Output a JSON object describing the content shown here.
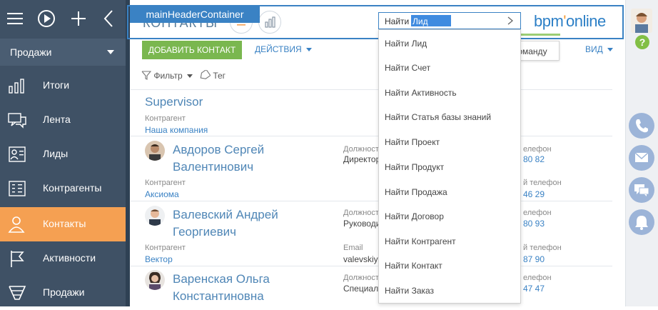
{
  "sidebar": {
    "section_label": "Продажи",
    "items": [
      {
        "label": "Итоги"
      },
      {
        "label": "Лента"
      },
      {
        "label": "Лиды"
      },
      {
        "label": "Контрагенты"
      },
      {
        "label": "Контакты"
      },
      {
        "label": "Активности"
      },
      {
        "label": "Продажи"
      }
    ]
  },
  "header": {
    "container_label": "mainHeaderContainer",
    "page_title": "КОНТАКТЫ",
    "command": {
      "typed": "Найти",
      "selected": "Лид"
    },
    "logo": {
      "left": "bpm",
      "dot": "'",
      "right": "online"
    }
  },
  "toolbar": {
    "add_label": "ДОБАВИТЬ КОНТАКТ",
    "actions_label": "ДЕЙСТВИЯ",
    "view_label": "ВИД",
    "filter_label": "Фильтр",
    "tag_label": "Тег"
  },
  "tooltip": {
    "label": "Выполнить команду"
  },
  "dropdown": {
    "items": [
      "Найти Лид",
      "Найти Счет",
      "Найти Активность",
      "Найти Статья базы знаний",
      "Найти Проект",
      "Найти Продукт",
      "Найти Продажа",
      "Найти Договор",
      "Найти Контрагент",
      "Найти Контакт",
      "Найти Заказ"
    ]
  },
  "records": [
    {
      "name": "Supervisor",
      "account_label": "Контрагент",
      "account": "Наша компания"
    },
    {
      "name_line1": "Авдоров Сергей",
      "name_line2": "Валентинович",
      "position_label": "Должност",
      "position": "Директор",
      "phone_label": "елефон",
      "phone": "80 82",
      "account_label": "Контрагент",
      "account": "Аксиома",
      "mobile_label": "й телефон",
      "mobile": "46 29"
    },
    {
      "name_line1": "Валевский Андрей",
      "name_line2": "Георгиевич",
      "position_label": "Должност",
      "position": "Руководи",
      "phone_label": "елефон",
      "phone": "80 93",
      "account_label": "Контрагент",
      "account": "Вектор",
      "email_label": "Email",
      "email": "valevskiy",
      "mobile_label": "й телефон",
      "mobile": "87 90"
    },
    {
      "name_line1": "Варенская Ольга",
      "name_line2": "Константиновна",
      "position_label": "Должност",
      "position": "Специал",
      "phone_label": "елефон",
      "phone": "47 47"
    }
  ],
  "right_panel": {
    "help": "?"
  },
  "colors": {
    "sidebar": "#3f5165",
    "active": "#f5a052",
    "accent": "#3a82c4",
    "add_button": "#7ab74f",
    "right_buttons": "#9cb4d8"
  }
}
